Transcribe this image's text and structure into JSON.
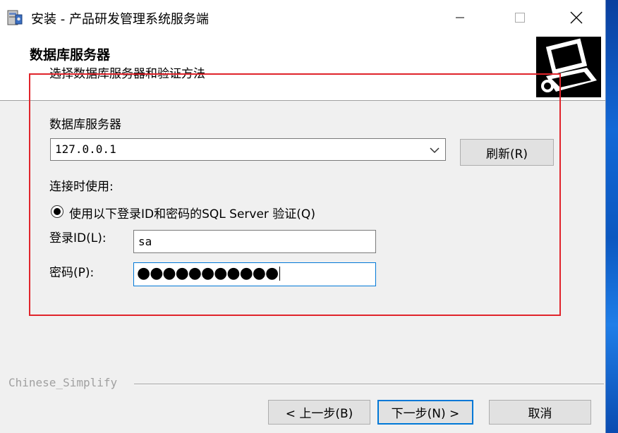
{
  "window": {
    "title": "安装 - 产品研发管理系统服务端"
  },
  "header": {
    "title": "数据库服务器",
    "subtitle": "选择数据库服务器和验证方法"
  },
  "form": {
    "server_label": "数据库服务器",
    "server_value": "127.0.0.1",
    "refresh_label": "刷新(R)",
    "connect_label": "连接时使用:",
    "auth_option_label": "使用以下登录ID和密码的SQL Server 验证(Q)",
    "auth_selected": true,
    "login_label": "登录ID(L):",
    "login_value": "sa",
    "password_label": "密码(P):",
    "password_mask": "●●●●●●●●●●●"
  },
  "footer": {
    "brand": "Chinese_Simplify",
    "back_label": "< 上一步(B)",
    "next_label": "下一步(N) >",
    "cancel_label": "取消"
  },
  "colors": {
    "highlight": "#e0242b",
    "focus": "#0078d7",
    "dialog_bg": "#f0f0f0"
  },
  "icons": [
    "installer-app-icon",
    "minimize-icon",
    "maximize-icon",
    "close-icon",
    "computer-header-icon",
    "chevron-down-icon",
    "radio-selected-icon"
  ]
}
